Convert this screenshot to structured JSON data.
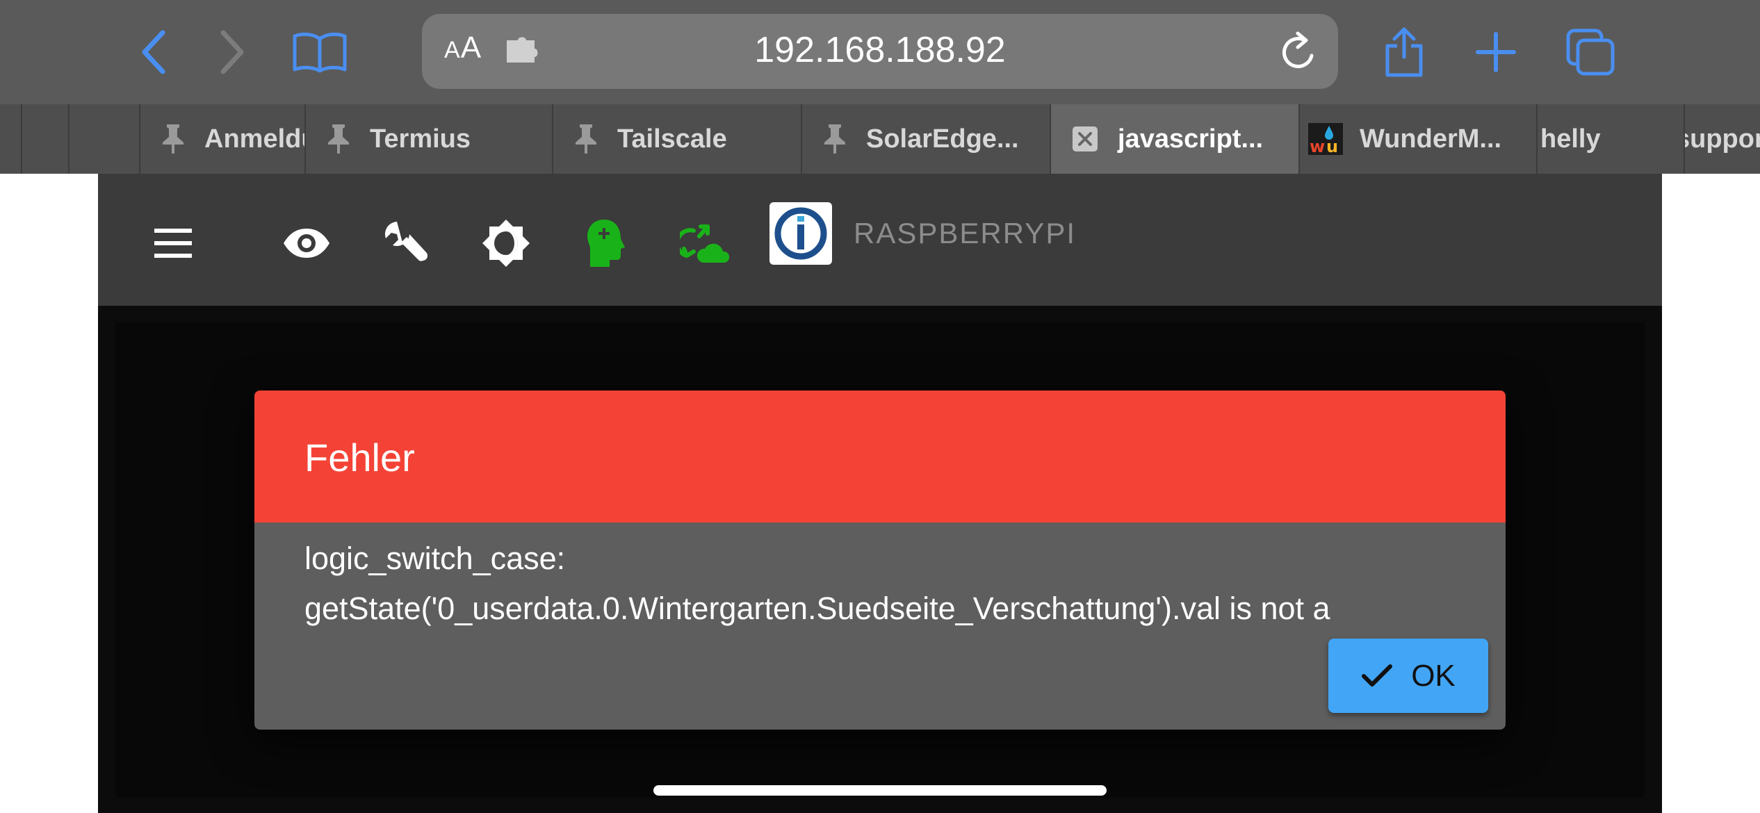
{
  "browser": {
    "url": "192.168.188.92",
    "text_size_label_small": "A",
    "text_size_label_large": "A"
  },
  "tabs": [
    {
      "title": "Anmeldung",
      "pinned": true,
      "active": false
    },
    {
      "title": "Termius",
      "pinned": true,
      "active": false
    },
    {
      "title": "Tailscale",
      "pinned": true,
      "active": false
    },
    {
      "title": "SolarEdge...",
      "pinned": true,
      "active": false
    },
    {
      "title": "javascript...",
      "pinned": false,
      "active": true
    },
    {
      "title": "WunderM...",
      "pinned": false,
      "active": false
    },
    {
      "title": "helly",
      "pinned": false,
      "active": false
    },
    {
      "title": "support",
      "pinned": false,
      "active": false
    }
  ],
  "app": {
    "host_name": "RASPBERRYPI",
    "icons": [
      "menu-icon",
      "eye-icon",
      "wrench-icon",
      "theme-brightness-icon",
      "expert-mode-head-icon",
      "cloud-sync-icon",
      "iobroker-logo"
    ],
    "colors": {
      "active_icon": "#19b319",
      "bar": "#3b3b3b",
      "background": "#0c0c0c"
    }
  },
  "dialog": {
    "title": "Fehler",
    "message_line1": "logic_switch_case:",
    "message_line2": "getState('0_userdata.0.Wintergarten.Suedseite_Verschattung').val is not a",
    "ok_label": "OK",
    "colors": {
      "header": "#f44336",
      "body": "#5e5e5e",
      "ok_button": "#42a5f5"
    }
  },
  "colors": {
    "browser_accent": "#4a8ef0"
  }
}
